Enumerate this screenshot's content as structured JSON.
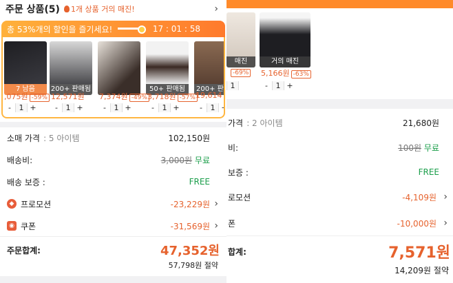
{
  "left": {
    "header": {
      "title": "주문 상품(5)",
      "note_icon": "flame-icon",
      "note": "1개 상품 거의 매진!"
    },
    "promo": {
      "text": "총 53%개의 할인을 즐기세요!",
      "timer": "17 : 01 : 58"
    },
    "items": [
      {
        "tag": "7 남음",
        "price": ",075원",
        "discount": "-59%",
        "qty": "1",
        "color": "#2b2b30"
      },
      {
        "tag": "200+ 판매됨",
        "price": "12,571원",
        "discount": "",
        "qty": "1",
        "color": "#4a4a4e"
      },
      {
        "tag": "",
        "price": "7,374원",
        "discount": "-49%",
        "qty": "1",
        "color": "#3a2e29"
      },
      {
        "tag": "50+ 판매됨",
        "price": "3,718원",
        "discount": "-57%",
        "qty": "1",
        "color": "#3b2a24"
      },
      {
        "tag": "200+ 판",
        "price": "19,614",
        "discount": "",
        "qty": "1",
        "color": "#5a4133"
      }
    ],
    "summary": {
      "retail_label": "소매 가격",
      "retail_count": ": 5 아이템",
      "retail_value": "102,150원",
      "shipping_label": "배송비:",
      "shipping_old": "3,000원",
      "shipping_free": "무료",
      "guarantee_label": "배송 보증 :",
      "guarantee_value": "FREE",
      "promo_label": "프로모션",
      "promo_value": "-23,229원",
      "coupon_label": "쿠폰",
      "coupon_value": "-31,569원",
      "total_label": "주문합계:",
      "total_value": "47,352원",
      "saved": "57,798원 절약"
    }
  },
  "right": {
    "items": [
      {
        "tag": "매진",
        "price": "",
        "discount": "-69%",
        "qty": "1"
      },
      {
        "tag": "거의 매진",
        "price": "5,166원",
        "discount": "-63%",
        "qty": "1"
      }
    ],
    "summary": {
      "retail_label": "가격",
      "retail_count": ": 2 아이템",
      "retail_value": "21,680원",
      "shipping_label": "비:",
      "shipping_old": "100원",
      "shipping_free": "무료",
      "guarantee_label": "보증 :",
      "guarantee_value": "FREE",
      "promo_label": "로모션",
      "promo_value": "-4,109원",
      "coupon_label": "폰",
      "coupon_value": "-10,000원",
      "total_label": "합계:",
      "total_value": "7,571원",
      "saved": "14,209원 절약"
    }
  }
}
